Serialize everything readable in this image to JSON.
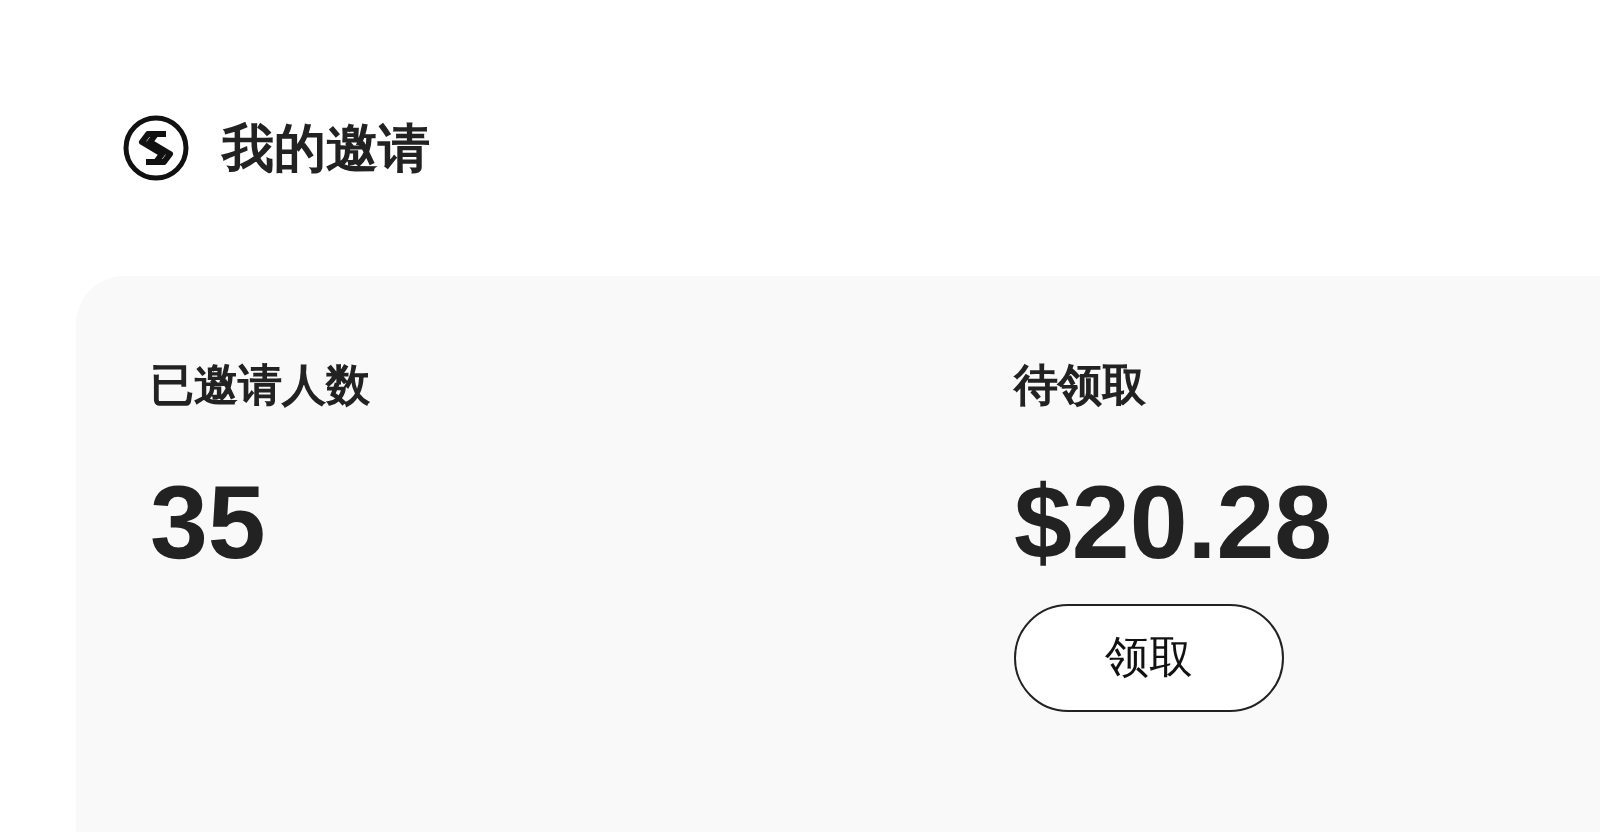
{
  "header": {
    "title": "我的邀请"
  },
  "stats": [
    {
      "label": "已邀请人数",
      "value": "35"
    },
    {
      "label": "待领取",
      "value": "$20.28",
      "button": "领取"
    }
  ]
}
